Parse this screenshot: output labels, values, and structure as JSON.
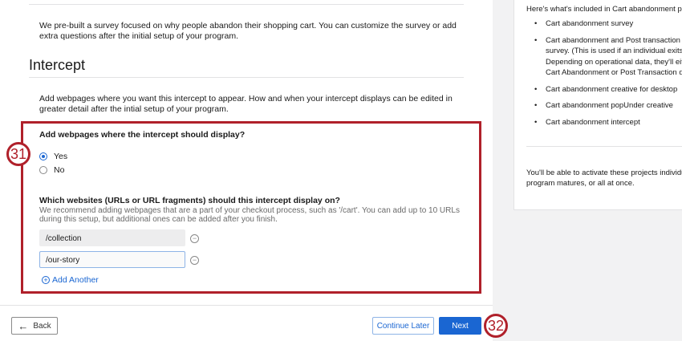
{
  "survey": {
    "description": "We pre-built a survey focused on why people abandon their shopping cart. You can customize the survey or add extra questions after the initial setup of your program."
  },
  "intercept": {
    "title": "Intercept",
    "description": "Add webpages where you want this intercept to appear. How and when your intercept displays can be edited in greater detail after the intial setup of your program.",
    "question1": "Add webpages where the intercept should display?",
    "options": [
      {
        "label": "Yes",
        "selected": true
      },
      {
        "label": "No",
        "selected": false
      }
    ],
    "question2": "Which websites (URLs or URL fragments) should this intercept display on?",
    "help": "We recommend adding webpages that are a part of your checkout process, such as '/cart'. You can add up to 10 URLs during this setup, but additional ones can be added after you finish.",
    "urls": [
      "/collection",
      "/our-story"
    ],
    "add_label": "Add Another"
  },
  "annotations": {
    "a1": "31",
    "a2": "32"
  },
  "footer": {
    "back": "Back",
    "continue_later": "Continue Later",
    "next": "Next"
  },
  "sidebar": {
    "intro": "Here's what's included in Cart abandonment project:",
    "items": [
      "Cart abandonment survey",
      "Cart abandonment and Post transaction comb",
      "survey. (This is used if an individual exits the s",
      "Depending on operational data, they'll either s",
      "Cart Abandonment or Post Transaction questi",
      "Cart abandonment creative for desktop",
      "Cart abandonment popUnder creative",
      "Cart abandonment intercept"
    ],
    "outro1": "You'll be able to activate these projects individually a",
    "outro2": "program matures, or all at once."
  },
  "colors": {
    "accent": "#1a66d2",
    "annotation": "#b0202a"
  }
}
